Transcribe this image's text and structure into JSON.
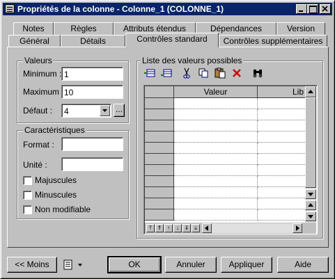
{
  "window": {
    "title": "Propriétés de la colonne - Colonne_1 (COLONNE_1)"
  },
  "tabs_row1": [
    "Notes",
    "Règles",
    "Attributs étendus",
    "Dépendances",
    "Version"
  ],
  "tabs_row2": [
    "Général",
    "Détails",
    "Contrôles standard",
    "Contrôles supplémentaires"
  ],
  "active_tab": "Contrôles standard",
  "valeurs": {
    "group_label": "Valeurs",
    "minimum_label": "Minimum :",
    "minimum_value": "1",
    "maximum_label": "Maximum :",
    "maximum_value": "10",
    "defaut_label": "Défaut :",
    "defaut_value": "4",
    "ellipsis": "..."
  },
  "caracteristiques": {
    "group_label": "Caractéristiques",
    "format_label": "Format :",
    "format_value": "",
    "unite_label": "Unité :",
    "unite_value": "",
    "majuscules": "Majuscules",
    "minuscules": "Minuscules",
    "non_modifiable": "Non modifiable",
    "majuscules_checked": false,
    "minuscules_checked": false,
    "non_modifiable_checked": false
  },
  "liste": {
    "label": "Liste des valeurs possibles",
    "columns": [
      "Valeur",
      "Lib"
    ],
    "toolbar_icons": [
      "insert-row-icon",
      "add-row-icon",
      "cut-icon",
      "copy-icon",
      "paste-icon",
      "delete-icon",
      "find-icon"
    ]
  },
  "footer": {
    "moins_label": "<< Moins",
    "ok_label": "OK",
    "annuler_label": "Annuler",
    "appliquer_label": "Appliquer",
    "aide_label": "Aide"
  },
  "colors": {
    "titlebar": "#0a246a",
    "face": "#c0c0c0",
    "delete_red": "#cc0000"
  }
}
